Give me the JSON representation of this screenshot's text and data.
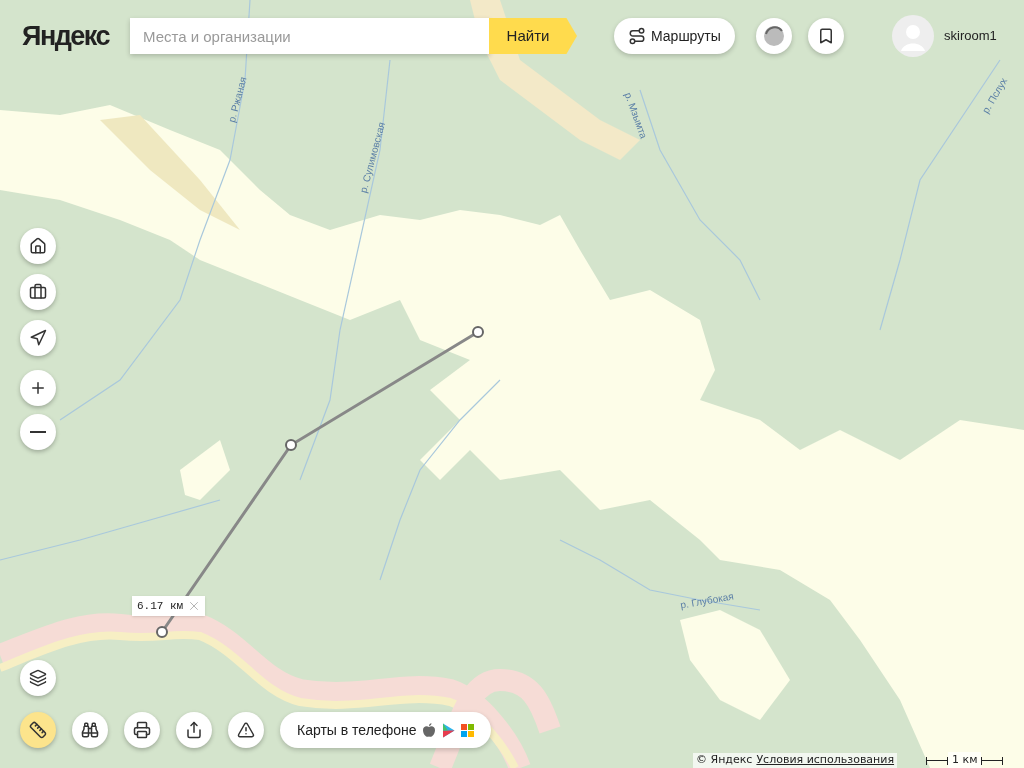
{
  "logo": "Яндекс",
  "search": {
    "placeholder": "Места и организации",
    "button": "Найти"
  },
  "routes_button": "Маршруты",
  "user": {
    "name": "skiroom1"
  },
  "map_labels": [
    {
      "text": "р. Ржаная",
      "kind": "steep-up"
    },
    {
      "text": "р. Сулимовская",
      "kind": "steep-up"
    },
    {
      "text": "р. Мзымта",
      "kind": "steep-down"
    },
    {
      "text": "р. Пслух",
      "kind": "slant-up"
    },
    {
      "text": "р. Глубокая",
      "kind": "flat"
    }
  ],
  "measurement": {
    "distance": "6.17 км"
  },
  "side_tools": [
    {
      "kind": "home"
    },
    {
      "kind": "briefcase"
    },
    {
      "kind": "locate"
    },
    {
      "kind": "zoom-in"
    },
    {
      "kind": "zoom-out"
    }
  ],
  "layers_button": {
    "kind": "layers"
  },
  "bottom_tools": [
    {
      "kind": "ruler",
      "selected": true
    },
    {
      "kind": "binoculars",
      "selected": false
    },
    {
      "kind": "print",
      "selected": false
    },
    {
      "kind": "share",
      "selected": false
    },
    {
      "kind": "report",
      "selected": false
    }
  ],
  "app_promo": "Карты в телефоне",
  "copyright": "© Яндекс",
  "terms_link": "Условия использования",
  "scale": "1 км"
}
